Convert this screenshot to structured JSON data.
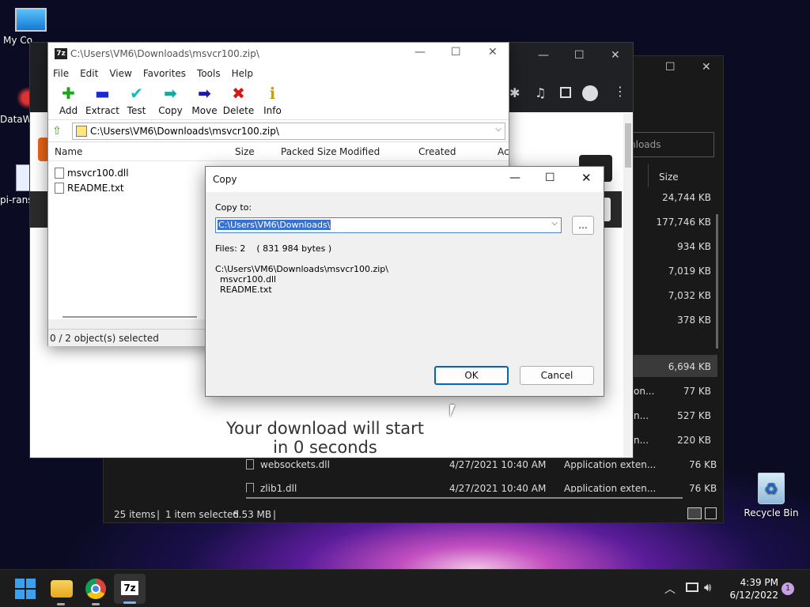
{
  "desktop": {
    "icons": [
      {
        "label": "My Co"
      },
      {
        "label": "DataW"
      },
      {
        "label": "pi-rans"
      },
      {
        "label": "Recycle Bin"
      }
    ]
  },
  "explorer": {
    "search_placeholder": "nloads",
    "size_header": "Size",
    "sizes": [
      "24,744 KB",
      "177,746 KB",
      "934 KB",
      "7,019 KB",
      "7,032 KB",
      "378 KB",
      "6,694 KB",
      "77 KB",
      "527 KB",
      "220 KB"
    ],
    "partial_types": [
      "on...",
      "n...",
      "n..."
    ],
    "rows": [
      {
        "name": "websockets.dll",
        "date": "4/27/2021 10:40 AM",
        "type": "Application exten...",
        "size": "76 KB"
      },
      {
        "name": "zlib1.dll",
        "date": "4/27/2021 10:40 AM",
        "type": "Application exten...",
        "size": "76 KB"
      }
    ],
    "status": {
      "items": "25 items",
      "selected": "1 item selected",
      "size": "6.53 MB"
    }
  },
  "chrome": {
    "download_line1": "Your download will start",
    "download_line2": "in 0 seconds"
  },
  "sevenzip": {
    "title": "C:\\Users\\VM6\\Downloads\\msvcr100.zip\\",
    "menu": [
      "File",
      "Edit",
      "View",
      "Favorites",
      "Tools",
      "Help"
    ],
    "toolbar": [
      {
        "label": "Add",
        "icon": "plus-icon",
        "glyph": "✚",
        "color": "#1aa51a"
      },
      {
        "label": "Extract",
        "icon": "minus-icon",
        "glyph": "▬",
        "color": "#1a2ad0"
      },
      {
        "label": "Test",
        "icon": "check-icon",
        "glyph": "✔",
        "color": "#12b8c0"
      },
      {
        "label": "Copy",
        "icon": "copy-arrow-icon",
        "glyph": "➡",
        "color": "#1aa5a0"
      },
      {
        "label": "Move",
        "icon": "move-arrow-icon",
        "glyph": "➡",
        "color": "#1a1aa5"
      },
      {
        "label": "Delete",
        "icon": "delete-icon",
        "glyph": "✖",
        "color": "#d01a1a"
      },
      {
        "label": "Info",
        "icon": "info-icon",
        "glyph": "ℹ",
        "color": "#c8a000"
      }
    ],
    "address": "C:\\Users\\VM6\\Downloads\\msvcr100.zip\\",
    "columns": [
      "Name",
      "Size",
      "Packed Size",
      "Modified",
      "Created",
      "Ac"
    ],
    "files": [
      {
        "name": "msvcr100.dll"
      },
      {
        "name": "README.txt"
      }
    ],
    "status": "0 / 2 object(s) selected"
  },
  "copy_dialog": {
    "title": "Copy",
    "copy_to_label": "Copy to:",
    "path_value": "C:\\Users\\VM6\\Downloads\\",
    "browse_label": "...",
    "files_info": "Files: 2    ( 831 984 bytes )",
    "source_path": "C:\\Users\\VM6\\Downloads\\msvcr100.zip\\",
    "source_files": [
      "msvcr100.dll",
      "README.txt"
    ],
    "ok_label": "OK",
    "cancel_label": "Cancel"
  },
  "taskbar": {
    "time": "4:39 PM",
    "date": "6/12/2022",
    "notification_count": "1",
    "sevenzip_label": "7z"
  }
}
